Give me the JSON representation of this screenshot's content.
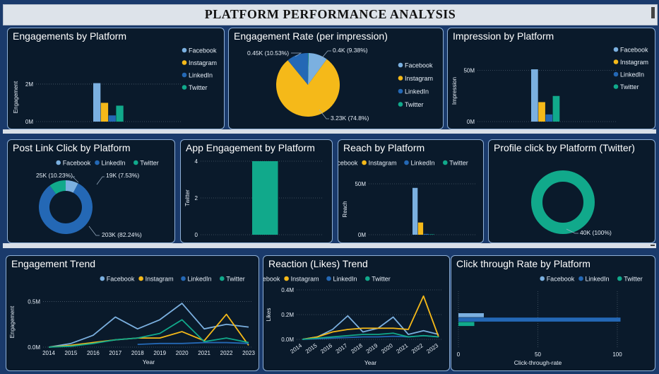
{
  "page_title": "PLATFORM PERFORMANCE ANALYSIS",
  "colors": {
    "Facebook": "#7bb0e0",
    "Instagram": "#f5b919",
    "LinkedIn": "#2468b5",
    "Twitter": "#11a98b"
  },
  "cards": {
    "engagements": {
      "title": "Engagements by Platform"
    },
    "engagement_rate": {
      "title": "Engagement Rate (per impression)"
    },
    "impression": {
      "title": "Impression by Platform"
    },
    "post_link_click": {
      "title": "Post Link Click by Platform"
    },
    "app_engagement": {
      "title": "App Engagement by Platform"
    },
    "reach": {
      "title": "Reach by Platform"
    },
    "profile_click": {
      "title": "Profile click by Platform (Twitter)"
    },
    "engagement_trend": {
      "title": "Engagement Trend"
    },
    "reaction_trend": {
      "title": "Reaction (Likes) Trend"
    },
    "ctr": {
      "title": "Click through Rate by Platform"
    }
  },
  "chart_data": [
    {
      "id": "engagements",
      "type": "bar",
      "categories": [
        "Facebook",
        "Instagram",
        "LinkedIn",
        "Twitter"
      ],
      "values": [
        2050000,
        1000000,
        330000,
        850000
      ],
      "ylabel": "Engagement",
      "yticks": [
        "0M",
        "2M"
      ],
      "ylim": [
        0,
        2600000
      ],
      "legend": [
        "Facebook",
        "Instagram",
        "LinkedIn",
        "Twitter"
      ],
      "legend_position": "right",
      "grid": true
    },
    {
      "id": "engagement_rate",
      "type": "pie",
      "categories": [
        "Facebook",
        "Instagram",
        "LinkedIn",
        "Twitter"
      ],
      "values": [
        0.4,
        3.23,
        0.45,
        0.01
      ],
      "labels": [
        "0.4K (9.38%)",
        "3.23K (74.8%)",
        "0.45K (10.53%)",
        ""
      ],
      "legend": [
        "Facebook",
        "Instagram",
        "LinkedIn",
        "Twitter"
      ],
      "legend_position": "right"
    },
    {
      "id": "impression",
      "type": "bar",
      "categories": [
        "Facebook",
        "Instagram",
        "LinkedIn",
        "Twitter"
      ],
      "values": [
        51000000,
        19000000,
        7000000,
        25000000
      ],
      "ylabel": "Impression",
      "yticks": [
        "0M",
        "50M"
      ],
      "ylim": [
        0,
        60000000
      ],
      "legend": [
        "Facebook",
        "Instagram",
        "LinkedIn",
        "Twitter"
      ],
      "legend_position": "right",
      "grid": true
    },
    {
      "id": "post_link_click",
      "type": "donut",
      "categories": [
        "Facebook",
        "LinkedIn",
        "Twitter"
      ],
      "values": [
        19,
        203,
        25
      ],
      "labels": [
        "19K (7.53%)",
        "203K (82.24%)",
        "25K (10.23%)"
      ],
      "legend": [
        "Facebook",
        "LinkedIn",
        "Twitter"
      ],
      "legend_position": "top"
    },
    {
      "id": "app_engagement",
      "type": "bar",
      "categories": [
        "Twitter"
      ],
      "values": [
        4
      ],
      "ylabel": "Twitter",
      "yticks": [
        "0",
        "2",
        "4"
      ],
      "ylim": [
        0,
        4
      ],
      "grid": true
    },
    {
      "id": "reach",
      "type": "bar",
      "categories": [
        "Facebook",
        "Instagram",
        "LinkedIn",
        "Twitter"
      ],
      "values": [
        46000000,
        12000000,
        800000,
        400000
      ],
      "ylabel": "Reach",
      "yticks": [
        "0M",
        "50M"
      ],
      "ylim": [
        0,
        50000000
      ],
      "legend": [
        "Facebook",
        "Instagram",
        "LinkedIn",
        "Twitter"
      ],
      "legend_position": "top",
      "grid": true
    },
    {
      "id": "profile_click",
      "type": "donut",
      "categories": [
        "Twitter"
      ],
      "values": [
        40
      ],
      "labels": [
        "40K (100%)"
      ]
    },
    {
      "id": "engagement_trend",
      "type": "line",
      "x": [
        2014,
        2015,
        2016,
        2017,
        2018,
        2019,
        2020,
        2021,
        2022,
        2023
      ],
      "xlabel": "Year",
      "ylabel": "Engagement",
      "yticks": [
        "0.0M",
        "0.5M"
      ],
      "ylim": [
        0,
        0.55
      ],
      "legend": [
        "Facebook",
        "Instagram",
        "LinkedIn",
        "Twitter"
      ],
      "legend_position": "top",
      "grid": true,
      "series": [
        {
          "name": "Facebook",
          "values": [
            0.0,
            0.04,
            0.13,
            0.33,
            0.2,
            0.3,
            0.48,
            0.2,
            0.25,
            0.22
          ]
        },
        {
          "name": "Instagram",
          "values": [
            0.0,
            0.02,
            0.05,
            0.08,
            0.1,
            0.1,
            0.17,
            0.07,
            0.36,
            0.02
          ]
        },
        {
          "name": "LinkedIn",
          "values": [
            null,
            null,
            null,
            null,
            0.03,
            0.04,
            0.04,
            0.05,
            0.05,
            0.04
          ]
        },
        {
          "name": "Twitter",
          "values": [
            0.0,
            0.01,
            0.04,
            0.08,
            0.1,
            0.15,
            0.3,
            0.06,
            0.1,
            0.05
          ]
        }
      ]
    },
    {
      "id": "reaction_trend",
      "type": "line",
      "x": [
        2014,
        2015,
        2016,
        2017,
        2018,
        2019,
        2020,
        2021,
        2022,
        2023
      ],
      "xlabel": "Year",
      "ylabel": "Likes",
      "yticks": [
        "0.0M",
        "0.2M",
        "0.4M"
      ],
      "ylim": [
        0,
        0.4
      ],
      "legend": [
        "Facebook",
        "Instagram",
        "LinkedIn",
        "Twitter"
      ],
      "legend_position": "top",
      "grid": true,
      "series": [
        {
          "name": "Facebook",
          "values": [
            0.0,
            0.02,
            0.08,
            0.19,
            0.06,
            0.09,
            0.18,
            0.04,
            0.07,
            0.04
          ]
        },
        {
          "name": "Instagram",
          "values": [
            0.0,
            0.02,
            0.06,
            0.08,
            0.09,
            0.09,
            0.09,
            0.08,
            0.35,
            0.02
          ]
        },
        {
          "name": "LinkedIn",
          "values": [
            0.0,
            0.005,
            0.01,
            0.015,
            0.02,
            0.02,
            0.025,
            0.02,
            0.03,
            0.02
          ]
        },
        {
          "name": "Twitter",
          "values": [
            0.0,
            0.01,
            0.02,
            0.03,
            0.04,
            0.04,
            0.05,
            0.02,
            0.03,
            0.02
          ]
        }
      ]
    },
    {
      "id": "ctr",
      "type": "hbar",
      "categories": [
        "Facebook",
        "LinkedIn",
        "Twitter"
      ],
      "values": [
        16,
        102,
        10
      ],
      "xlabel": "Click-through-rate",
      "xticks": [
        "0",
        "50",
        "100"
      ],
      "xlim": [
        0,
        100
      ],
      "legend": [
        "Facebook",
        "LinkedIn",
        "Twitter"
      ],
      "legend_position": "top",
      "grid": true
    }
  ]
}
